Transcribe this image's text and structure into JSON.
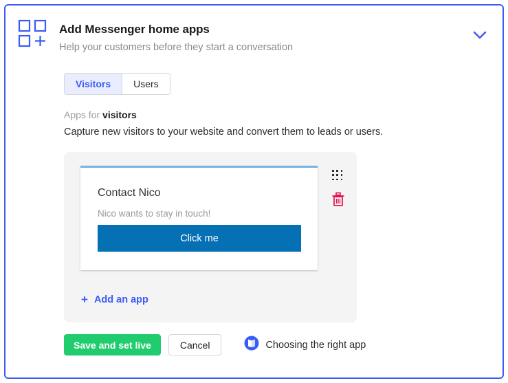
{
  "panel": {
    "border_color": "#3b5bf5"
  },
  "header": {
    "icon": "apps-grid-add-icon",
    "title": "Add Messenger home apps",
    "subtitle": "Help your customers before they start a conversation",
    "collapse_icon": "chevron-down-icon"
  },
  "tabs": [
    {
      "label": "Visitors",
      "active": true
    },
    {
      "label": "Users",
      "active": false
    }
  ],
  "section": {
    "label_muted": "Apps for ",
    "label_strong": "visitors",
    "description": "Capture new visitors to your website and convert them to leads or users."
  },
  "app_card": {
    "title": "Contact Nico",
    "subtitle": "Nico wants to stay in touch!",
    "button_label": "Click me",
    "button_color": "#0670b5",
    "accent_top_color": "#7bb4e3",
    "drag_icon": "drag-handle-dots-icon",
    "delete_icon": "trash-icon",
    "delete_icon_color": "#e8114b"
  },
  "add_app": {
    "plus": "+",
    "label": "Add an app",
    "color": "#3b5bf5"
  },
  "footer": {
    "save_label": "Save and set live",
    "save_color": "#21cc6f",
    "cancel_label": "Cancel",
    "help_icon": "book-icon",
    "help_label": "Choosing the right app"
  }
}
